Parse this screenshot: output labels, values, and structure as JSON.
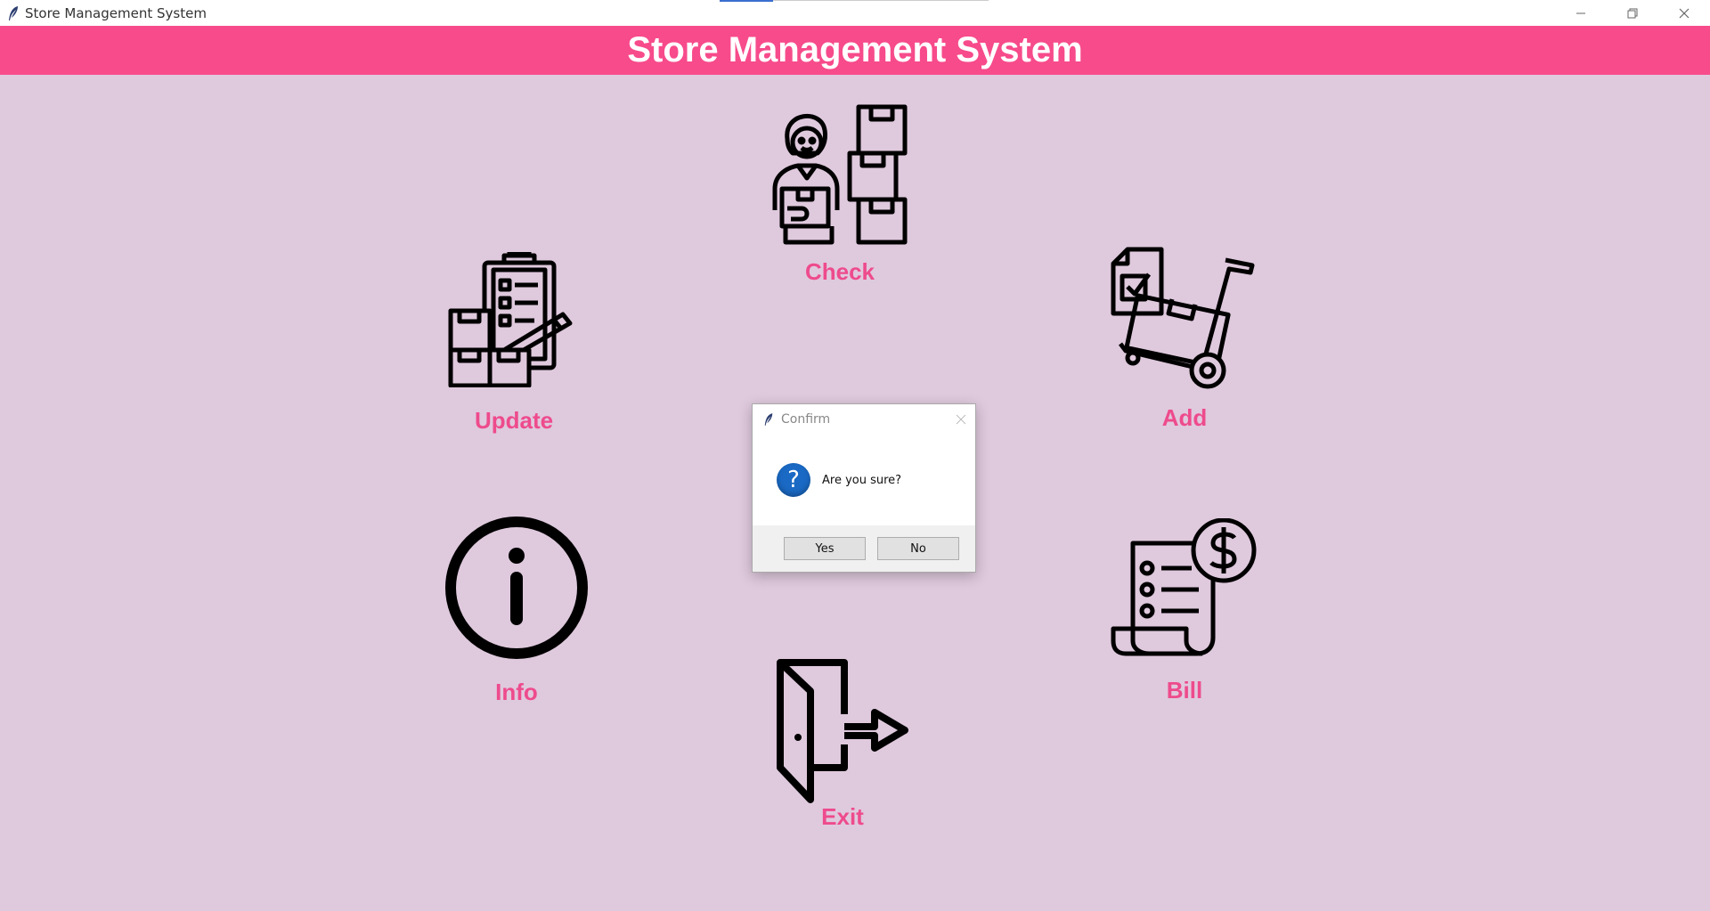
{
  "window": {
    "title": "Store Management System",
    "minimize_icon": "minimize-icon",
    "restore_icon": "restore-icon",
    "close_icon": "close-icon"
  },
  "header": {
    "title": "Store Management System"
  },
  "menu": {
    "check": {
      "label": "Check",
      "icon": "worker-boxes-icon"
    },
    "update": {
      "label": "Update",
      "icon": "clipboard-boxes-icon"
    },
    "add": {
      "label": "Add",
      "icon": "hand-truck-icon"
    },
    "info": {
      "label": "Info",
      "icon": "info-icon"
    },
    "bill": {
      "label": "Bill",
      "icon": "receipt-dollar-icon"
    },
    "exit": {
      "label": "Exit",
      "icon": "exit-door-icon"
    }
  },
  "dialog": {
    "title": "Confirm",
    "message": "Are you sure?",
    "icon": "question-icon",
    "yes_label": "Yes",
    "no_label": "No"
  },
  "colors": {
    "background": "#dfc9dd",
    "header": "#f74b8b",
    "label": "#ee4b8c"
  }
}
